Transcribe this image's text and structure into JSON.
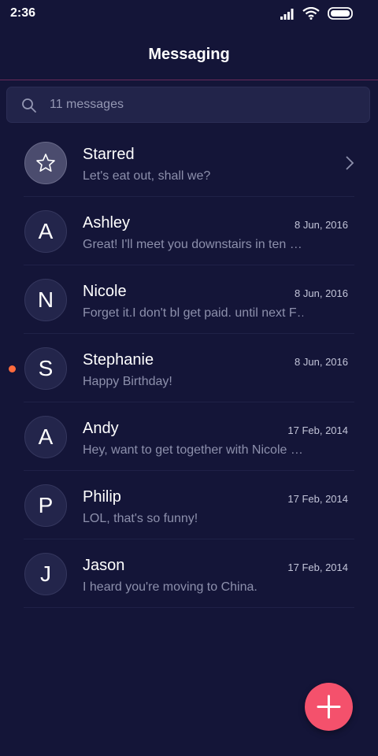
{
  "status_bar": {
    "time": "2:36",
    "icons": [
      "signal-icon",
      "wifi-icon",
      "battery-icon"
    ]
  },
  "header": {
    "title": "Messaging"
  },
  "search": {
    "placeholder": "11 messages",
    "icon": "search-icon"
  },
  "conversations": [
    {
      "name": "Starred",
      "avatar": "star-icon",
      "preview": "Let's eat out, shall we?",
      "date": "",
      "unread": false,
      "has_chevron": true
    },
    {
      "name": "Ashley",
      "avatar": "A",
      "preview": "Great! I'll meet you downstairs in ten …",
      "date": "8 Jun, 2016",
      "unread": false
    },
    {
      "name": "Nicole",
      "avatar": "N",
      "preview": "Forget it.I don't bl get paid. until next F…",
      "date": "8 Jun, 2016",
      "unread": false
    },
    {
      "name": "Stephanie",
      "avatar": "S",
      "preview": "Happy Birthday!",
      "date": "8 Jun, 2016",
      "unread": true
    },
    {
      "name": "Andy",
      "avatar": "A",
      "preview": "Hey, want to get together with Nicole …",
      "date": "17 Feb, 2014",
      "unread": false
    },
    {
      "name": "Philip",
      "avatar": "P",
      "preview": "LOL, that's so funny!",
      "date": "17 Feb, 2014",
      "unread": false
    },
    {
      "name": "Jason",
      "avatar": "J",
      "preview": "I heard you're moving to China.",
      "date": "17 Feb, 2014",
      "unread": false
    }
  ],
  "fab": {
    "icon": "plus-icon"
  },
  "colors": {
    "background": "#141538",
    "accent": "#f4516c",
    "unread_dot": "#ff6b3d",
    "divider_header": "#6a2a5a"
  }
}
